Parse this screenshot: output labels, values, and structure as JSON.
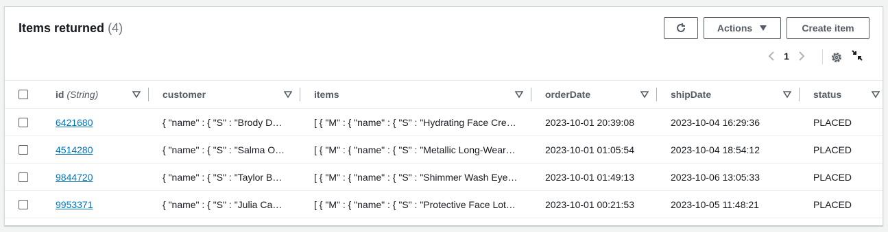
{
  "header": {
    "title": "Items returned",
    "count": "(4)"
  },
  "toolbar": {
    "refresh_icon": "refresh-icon",
    "actions_label": "Actions",
    "create_label": "Create item"
  },
  "pagination": {
    "current_page": "1"
  },
  "table": {
    "columns": [
      {
        "label": "id",
        "type": "(String)"
      },
      {
        "label": "customer"
      },
      {
        "label": "items"
      },
      {
        "label": "orderDate"
      },
      {
        "label": "shipDate"
      },
      {
        "label": "status"
      }
    ],
    "rows": [
      {
        "id": "6421680",
        "customer": "{ \"name\" : { \"S\" : \"Brody De…",
        "items": "[ { \"M\" : { \"name\" : { \"S\" : \"Hydrating Face Cre…",
        "orderDate": "2023-10-01 20:39:08",
        "shipDate": "2023-10-04 16:29:36",
        "status": "PLACED"
      },
      {
        "id": "4514280",
        "customer": "{ \"name\" : { \"S\" : \"Salma O…",
        "items": "[ { \"M\" : { \"name\" : { \"S\" : \"Metallic Long-Wear…",
        "orderDate": "2023-10-01 01:05:54",
        "shipDate": "2023-10-04 18:54:12",
        "status": "PLACED"
      },
      {
        "id": "9844720",
        "customer": "{ \"name\" : { \"S\" : \"Taylor B…",
        "items": "[ { \"M\" : { \"name\" : { \"S\" : \"Shimmer Wash Eye…",
        "orderDate": "2023-10-01 01:49:13",
        "shipDate": "2023-10-06 13:05:33",
        "status": "PLACED"
      },
      {
        "id": "9953371",
        "customer": "{ \"name\" : { \"S\" : \"Julia Cas…",
        "items": "[ { \"M\" : { \"name\" : { \"S\" : \"Protective Face Lot…",
        "orderDate": "2023-10-01 00:21:53",
        "shipDate": "2023-10-05 11:48:21",
        "status": "PLACED"
      }
    ]
  },
  "colors": {
    "link": "#0073bb",
    "header_text": "#545b64",
    "border": "#eaeded"
  }
}
